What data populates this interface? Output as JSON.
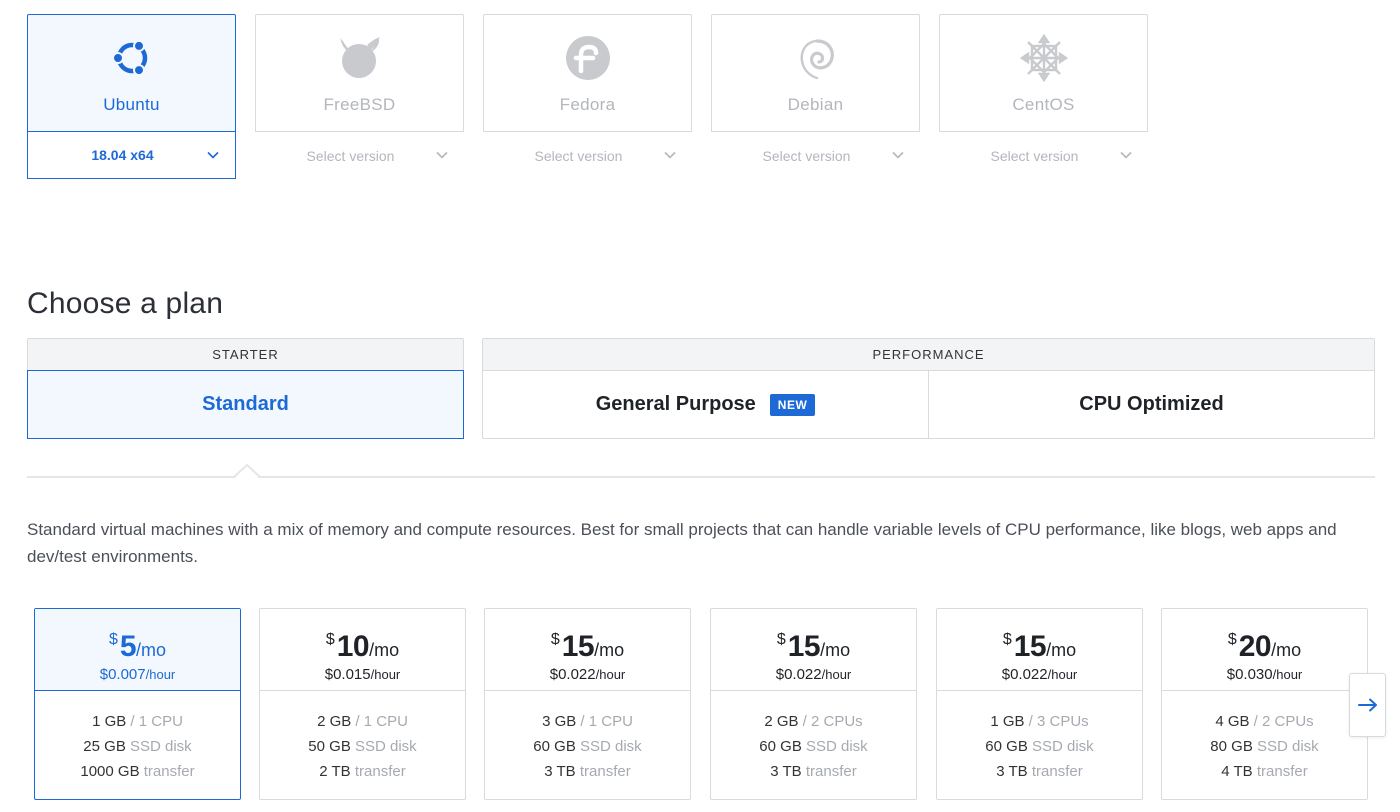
{
  "distributions": [
    {
      "name": "Ubuntu",
      "version": "18.04 x64",
      "icon": "ubuntu-icon",
      "selected": true
    },
    {
      "name": "FreeBSD",
      "version": "Select version",
      "icon": "freebsd-icon",
      "selected": false
    },
    {
      "name": "Fedora",
      "version": "Select version",
      "icon": "fedora-icon",
      "selected": false
    },
    {
      "name": "Debian",
      "version": "Select version",
      "icon": "debian-icon",
      "selected": false
    },
    {
      "name": "CentOS",
      "version": "Select version",
      "icon": "centos-icon",
      "selected": false
    }
  ],
  "plan": {
    "title": "Choose a plan",
    "starter": {
      "header": "STARTER",
      "options": [
        {
          "label": "Standard",
          "active": true
        }
      ]
    },
    "performance": {
      "header": "PERFORMANCE",
      "options": [
        {
          "label": "General Purpose",
          "badge": "NEW"
        },
        {
          "label": "CPU Optimized"
        }
      ]
    },
    "description": "Standard virtual machines with a mix of memory and compute resources. Best for small projects that can handle variable levels of CPU performance, like blogs, web apps and dev/test environments."
  },
  "prices": [
    {
      "currency": "$",
      "amount": "5",
      "per": "/mo",
      "hourly": "$0.007",
      "hourly_unit": "/hour",
      "memory": "1 GB",
      "cpu": "/ 1 CPU",
      "disk": "25 GB",
      "disk_label": "SSD disk",
      "transfer": "1000 GB",
      "transfer_label": "transfer",
      "selected": true
    },
    {
      "currency": "$",
      "amount": "10",
      "per": "/mo",
      "hourly": "$0.015",
      "hourly_unit": "/hour",
      "memory": "2 GB",
      "cpu": "/ 1 CPU",
      "disk": "50 GB",
      "disk_label": "SSD disk",
      "transfer": "2 TB",
      "transfer_label": "transfer",
      "selected": false
    },
    {
      "currency": "$",
      "amount": "15",
      "per": "/mo",
      "hourly": "$0.022",
      "hourly_unit": "/hour",
      "memory": "3 GB",
      "cpu": "/ 1 CPU",
      "disk": "60 GB",
      "disk_label": "SSD disk",
      "transfer": "3 TB",
      "transfer_label": "transfer",
      "selected": false
    },
    {
      "currency": "$",
      "amount": "15",
      "per": "/mo",
      "hourly": "$0.022",
      "hourly_unit": "/hour",
      "memory": "2 GB",
      "cpu": "/ 2 CPUs",
      "disk": "60 GB",
      "disk_label": "SSD disk",
      "transfer": "3 TB",
      "transfer_label": "transfer",
      "selected": false
    },
    {
      "currency": "$",
      "amount": "15",
      "per": "/mo",
      "hourly": "$0.022",
      "hourly_unit": "/hour",
      "memory": "1 GB",
      "cpu": "/ 3 CPUs",
      "disk": "60 GB",
      "disk_label": "SSD disk",
      "transfer": "3 TB",
      "transfer_label": "transfer",
      "selected": false
    },
    {
      "currency": "$",
      "amount": "20",
      "per": "/mo",
      "hourly": "$0.030",
      "hourly_unit": "/hour",
      "memory": "4 GB",
      "cpu": "/ 2 CPUs",
      "disk": "80 GB",
      "disk_label": "SSD disk",
      "transfer": "4 TB",
      "transfer_label": "transfer",
      "selected": false
    }
  ],
  "colors": {
    "accent": "#1d6ad6",
    "border": "#d8dade",
    "muted": "#b3b6bc",
    "selected_bg": "#f3f8fe"
  }
}
